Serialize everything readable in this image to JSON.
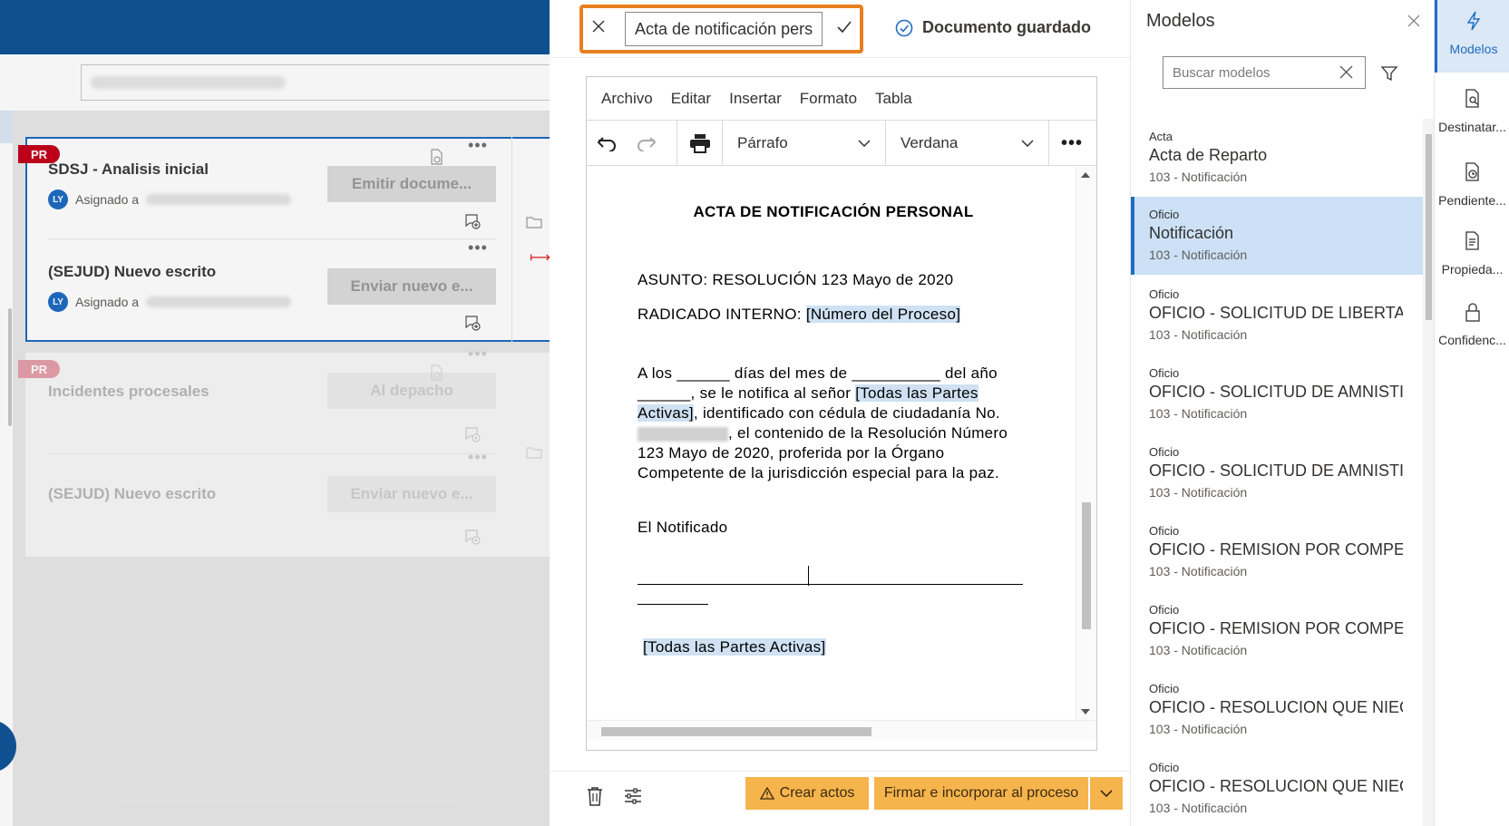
{
  "background": {
    "cards": [
      {
        "badge": "PR",
        "title": "SDSJ - Analisis inicial",
        "assignee_avatar": "LY",
        "assigned_label": "Asignado a",
        "action": "Emitir docume..."
      },
      {
        "title": "(SEJUD) Nuevo escrito",
        "assignee_avatar": "LY",
        "assigned_label": "Asignado a",
        "action": "Enviar nuevo e..."
      },
      {
        "badge": "PR",
        "title": "Incidentes procesales",
        "action": "Al depacho"
      },
      {
        "title": "(SEJUD) Nuevo escrito",
        "action": "Enviar nuevo e..."
      }
    ]
  },
  "editor": {
    "doc_name_value": "Acta de notificación personal",
    "saved_status": "Documento guardado",
    "menu": [
      "Archivo",
      "Editar",
      "Insertar",
      "Formato",
      "Tabla"
    ],
    "toolbar": {
      "block_format": "Párrafo",
      "font": "Verdana"
    },
    "document": {
      "title": "ACTA DE NOTIFICACIÓN PERSONAL",
      "asunto": "ASUNTO: RESOLUCIÓN 123 Mayo de 2020",
      "radicado_label": "RADICADO INTERNO: ",
      "radicado_placeholder": "[Número del Proceso]",
      "para_1": "A los ______ días del mes de __________ del año ______, se le notifica al señor ",
      "para_placeholder": "[Todas las Partes Activas]",
      "para_2": ", identificado con cédula de ciudadanía No. ",
      "para_3": ", el contenido de la Resolución  Número 123 Mayo de 2020, proferida por la Órgano Competente   de la jurisdicción especial para la paz.",
      "notificado": "El Notificado",
      "signature_placeholder": "[Todas las Partes Activas]"
    },
    "footer": {
      "crear_actos": "Crear actos",
      "firmar": "Firmar e incorporar al proceso"
    }
  },
  "modelos": {
    "title": "Modelos",
    "search_placeholder": "Buscar modelos",
    "items": [
      {
        "category": "Acta",
        "name": "Acta de Reparto",
        "sub": "103 - Notificación"
      },
      {
        "category": "Oficio",
        "name": "Notificación",
        "sub": "103 - Notificación",
        "selected": true
      },
      {
        "category": "Oficio",
        "name": "OFICIO - SOLICITUD DE LIBERTAD C",
        "sub": "103 - Notificación"
      },
      {
        "category": "Oficio",
        "name": "OFICIO - SOLICITUD DE AMNISTIA",
        "sub": "103 - Notificación"
      },
      {
        "category": "Oficio",
        "name": "OFICIO - SOLICITUD DE AMNISTIA -",
        "sub": "103 - Notificación"
      },
      {
        "category": "Oficio",
        "name": "OFICIO - REMISION POR COMPETEI",
        "sub": "103 - Notificación"
      },
      {
        "category": "Oficio",
        "name": "OFICIO - REMISION POR COMPETEI",
        "sub": "103 - Notificación"
      },
      {
        "category": "Oficio",
        "name": "OFICIO - RESOLUCION QUE NIEGA",
        "sub": "103 - Notificación"
      },
      {
        "category": "Oficio",
        "name": "OFICIO - RESOLUCION QUE NIEGA",
        "sub": "103 - Notificación"
      }
    ]
  },
  "rail": {
    "items": [
      "Modelos",
      "Destinatar...",
      "Pendiente...",
      "Propieda...",
      "Confidenc..."
    ]
  },
  "colors": {
    "header": "#0f5496",
    "accent": "#1f6cc2",
    "highlight_border": "#e97f1e",
    "action_button": "#f6b44d",
    "badge_red": "#c4001c"
  }
}
